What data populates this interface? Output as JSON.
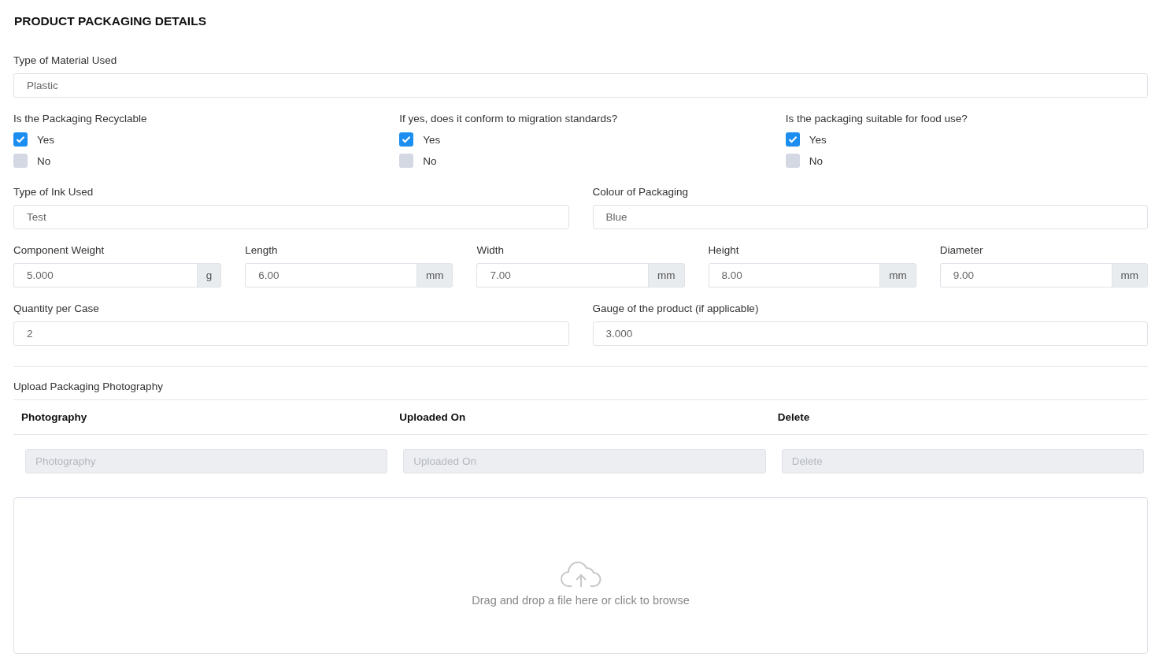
{
  "title": "PRODUCT PACKAGING DETAILS",
  "material": {
    "label": "Type of Material Used",
    "value": "Plastic"
  },
  "questions": [
    {
      "label": "Is the Packaging Recyclable",
      "options": [
        {
          "label": "Yes",
          "checked": true
        },
        {
          "label": "No",
          "checked": false
        }
      ]
    },
    {
      "label": "If yes, does it conform to migration standards?",
      "options": [
        {
          "label": "Yes",
          "checked": true
        },
        {
          "label": "No",
          "checked": false
        }
      ]
    },
    {
      "label": "Is the packaging suitable for food use?",
      "options": [
        {
          "label": "Yes",
          "checked": true
        },
        {
          "label": "No",
          "checked": false
        }
      ]
    }
  ],
  "ink": {
    "label": "Type of Ink Used",
    "value": "Test"
  },
  "colour": {
    "label": "Colour of Packaging",
    "value": "Blue"
  },
  "measurements": [
    {
      "label": "Component Weight",
      "value": "5.000",
      "unit": "g"
    },
    {
      "label": "Length",
      "value": "6.00",
      "unit": "mm"
    },
    {
      "label": "Width",
      "value": "7.00",
      "unit": "mm"
    },
    {
      "label": "Height",
      "value": "8.00",
      "unit": "mm"
    },
    {
      "label": "Diameter",
      "value": "9.00",
      "unit": "mm"
    }
  ],
  "quantity": {
    "label": "Quantity per Case",
    "value": "2"
  },
  "gauge": {
    "label": "Gauge of the product (if applicable)",
    "value": "3.000"
  },
  "upload": {
    "label": "Upload Packaging Photography",
    "columns": [
      "Photography",
      "Uploaded On",
      "Delete"
    ],
    "placeholders": [
      "Photography",
      "Uploaded On",
      "Delete"
    ],
    "dropzone": "Drag and drop a file here or click to browse"
  }
}
